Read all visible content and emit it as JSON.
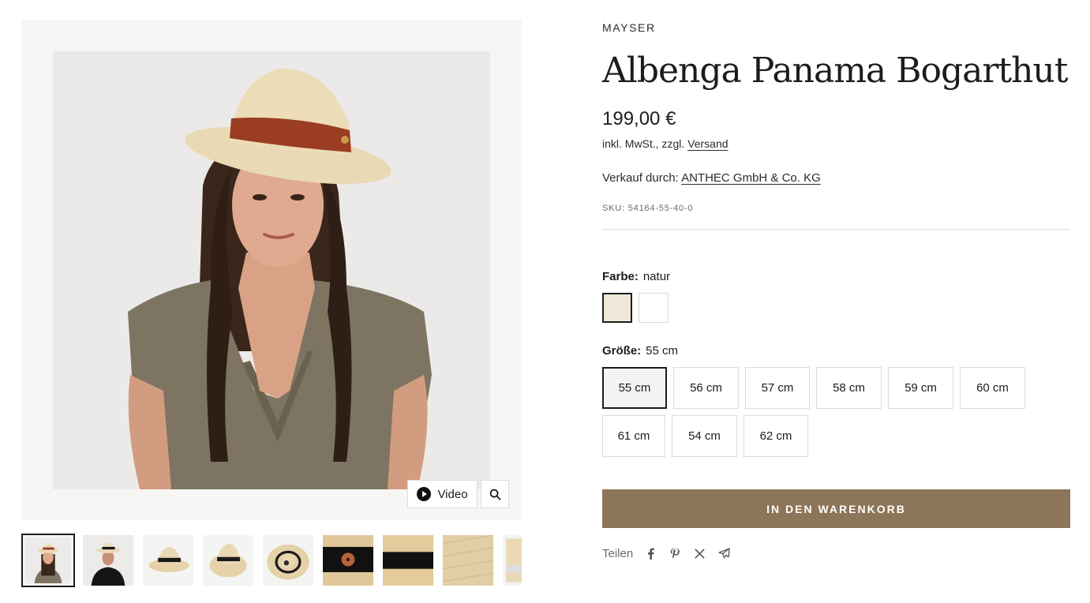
{
  "gallery": {
    "video_label": "Video",
    "icons": {
      "play": "play-icon",
      "zoom": "search-icon"
    },
    "thumbnail_count_visible": 9
  },
  "product": {
    "brand": "MAYSER",
    "title": "Albenga Panama Bogarthut",
    "price": "199,00 €",
    "tax_prefix": "inkl. MwSt., zzgl.",
    "tax_link": "Versand",
    "seller_prefix": "Verkauf durch:",
    "seller_link": "ANTHEC GmbH & Co. KG",
    "sku": "SKU: 54164-55-40-0"
  },
  "options": {
    "color": {
      "label": "Farbe:",
      "value": "natur",
      "swatches": [
        {
          "name": "natur",
          "color": "#efe8d8",
          "selected": true
        },
        {
          "name": "white",
          "color": "#ffffff",
          "selected": false
        }
      ]
    },
    "size": {
      "label": "Größe:",
      "value": "55 cm",
      "choices": [
        "55 cm",
        "56 cm",
        "57 cm",
        "58 cm",
        "59 cm",
        "60 cm",
        "61 cm",
        "54 cm",
        "62 cm"
      ],
      "selected_index": 0
    }
  },
  "cart": {
    "label": "IN DEN WARENKORB",
    "color": "#8c7558"
  },
  "share": {
    "label": "Teilen",
    "icons": [
      "facebook-icon",
      "pinterest-icon",
      "x-icon",
      "telegram-icon"
    ]
  }
}
